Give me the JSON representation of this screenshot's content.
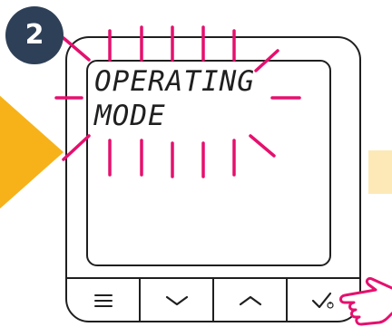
{
  "step": {
    "number": "2",
    "badge_color": "#2e4057"
  },
  "display": {
    "line1": "OPERATING",
    "line2": "MODE",
    "blinking": true,
    "blink_color": "#e5106e"
  },
  "controls": {
    "buttons": [
      {
        "icon": "menu-icon"
      },
      {
        "icon": "chevron-down-icon"
      },
      {
        "icon": "chevron-up-icon"
      },
      {
        "icon": "check-power-icon"
      }
    ]
  },
  "colors": {
    "arrow": "#f7b21a",
    "arrow_faint": "#fde9b8",
    "outline": "#1f1f1f",
    "accent": "#e5106e"
  },
  "icons": [
    "next-step-arrow-icon",
    "pointing-hand-icon"
  ]
}
